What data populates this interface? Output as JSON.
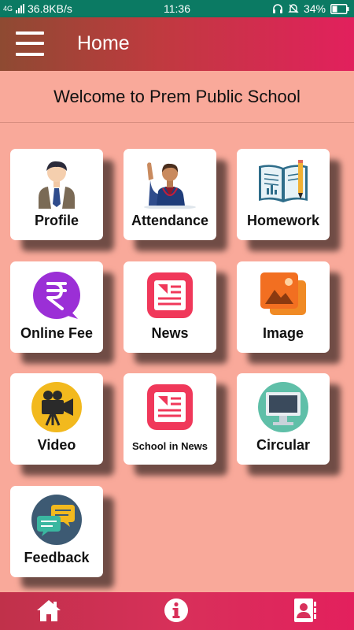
{
  "status_bar": {
    "network": "4G",
    "speed": "36.8KB/s",
    "time": "11:36",
    "battery": "34%"
  },
  "app_bar": {
    "title": "Home",
    "menu_icon": "hamburger-menu-icon"
  },
  "welcome_text": "Welcome to Prem Public School",
  "tiles": [
    {
      "label": "Profile",
      "icon": "student-icon"
    },
    {
      "label": "Attendance",
      "icon": "student-raising-hand-icon"
    },
    {
      "label": "Homework",
      "icon": "book-pencil-icon"
    },
    {
      "label": "Online Fee",
      "icon": "rupee-chat-icon"
    },
    {
      "label": "News",
      "icon": "news-icon"
    },
    {
      "label": "Image",
      "icon": "image-gallery-icon"
    },
    {
      "label": "Video",
      "icon": "video-camera-icon"
    },
    {
      "label": "School in News",
      "icon": "news-icon"
    },
    {
      "label": "Circular",
      "icon": "monitor-icon"
    },
    {
      "label": "Feedback",
      "icon": "chat-bubbles-icon"
    }
  ],
  "bottom_nav": [
    {
      "icon": "home-icon"
    },
    {
      "icon": "info-icon"
    },
    {
      "icon": "contact-book-icon"
    }
  ],
  "colors": {
    "status_bar": "#0b7a63",
    "background": "#f9a99a",
    "app_bar_start": "#8e4a32",
    "app_bar_end": "#e2205d",
    "tile": "#ffffff"
  }
}
